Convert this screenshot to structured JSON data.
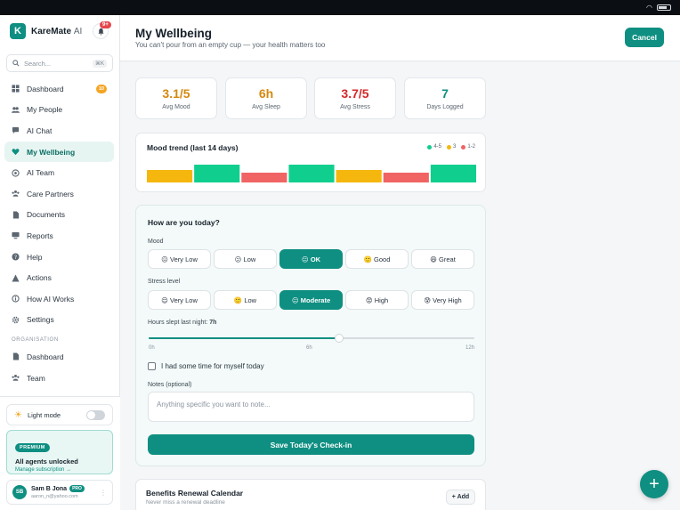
{
  "colors": {
    "accent": "#0f8f82",
    "mood": "#d4880f",
    "stress": "#d62828",
    "days": "#0f8f82",
    "good": "#10cf8e",
    "mid": "#f5b70d",
    "low": "#f06464"
  },
  "sidebar": {
    "brand_name": "KareMate",
    "brand_ai": "AI",
    "notif_badge": "9+",
    "search_placeholder": "Search...",
    "search_kbd": "⌘K",
    "items": [
      {
        "label": "Dashboard",
        "icon": "grid-icon",
        "badge": "10"
      },
      {
        "label": "My People",
        "icon": "people-icon"
      },
      {
        "label": "AI Chat",
        "icon": "chat-icon"
      },
      {
        "label": "My Wellbeing",
        "icon": "heart-icon",
        "active": true
      },
      {
        "label": "AI Team",
        "icon": "team-icon"
      },
      {
        "label": "Care Partners",
        "icon": "partners-icon"
      },
      {
        "label": "Documents",
        "icon": "document-icon"
      },
      {
        "label": "Reports",
        "icon": "reports-icon"
      },
      {
        "label": "Help",
        "icon": "help-icon"
      },
      {
        "label": "Actions",
        "icon": "actions-icon"
      },
      {
        "label": "How AI Works",
        "icon": "info-icon"
      },
      {
        "label": "Settings",
        "icon": "gear-icon"
      }
    ],
    "org_section": "ORGANISATION",
    "org_items": [
      {
        "label": "Dashboard",
        "icon": "grid-icon"
      },
      {
        "label": "Team",
        "icon": "team-icon"
      }
    ],
    "light_mode_label": "Light mode",
    "premium": {
      "badge": "PREMIUM",
      "title": "All agents unlocked",
      "link": "Manage subscription →"
    },
    "user": {
      "initials": "SB",
      "name": "Sam B Jona",
      "plan": "PRO",
      "email": "aaron_n@yahoo.com"
    }
  },
  "header": {
    "title": "My Wellbeing",
    "subtitle": "You can't pour from an empty cup — your health matters too",
    "cancel_label": "Cancel"
  },
  "stats": [
    {
      "value": "3.1/5",
      "label": "Avg Mood",
      "color": "#d4880f"
    },
    {
      "value": "6h",
      "label": "Avg Sleep",
      "color": "#d4880f"
    },
    {
      "value": "3.7/5",
      "label": "Avg Stress",
      "color": "#d62828"
    },
    {
      "value": "7",
      "label": "Days Logged",
      "color": "#0f8f82"
    }
  ],
  "trend": {
    "title": "Mood trend (last 14 days)",
    "legend": [
      {
        "label": "4-5",
        "color": "#10cf8e"
      },
      {
        "label": "3",
        "color": "#f5b70d"
      },
      {
        "label": "1-2",
        "color": "#f06464"
      }
    ],
    "entries": [
      3,
      5,
      2,
      5,
      3,
      2,
      5
    ]
  },
  "checkin": {
    "title": "How are you today?",
    "mood_label": "Mood",
    "mood_options": [
      "😖 Very Low",
      "😕 Low",
      "😐 OK",
      "🙂 Good",
      "😄 Great"
    ],
    "mood_selected": 2,
    "stress_label": "Stress level",
    "stress_options": [
      "😌 Very Low",
      "🙂 Low",
      "😐 Moderate",
      "😟 High",
      "😰 Very High"
    ],
    "stress_selected": 2,
    "sleep_label": "Hours slept last night:",
    "sleep_value": "7h",
    "sleep_hours": 7,
    "sleep_max": 12,
    "ticks": [
      "0h",
      "6h",
      "12h"
    ],
    "me_time_label": "I had some time for myself today",
    "notes_label": "Notes (optional)",
    "notes_placeholder": "Anything specific you want to note...",
    "save_label": "Save Today's Check-in"
  },
  "benefits": {
    "title": "Benefits Renewal Calendar",
    "subtitle": "Never miss a renewal deadline",
    "add_label": "+ Add"
  }
}
